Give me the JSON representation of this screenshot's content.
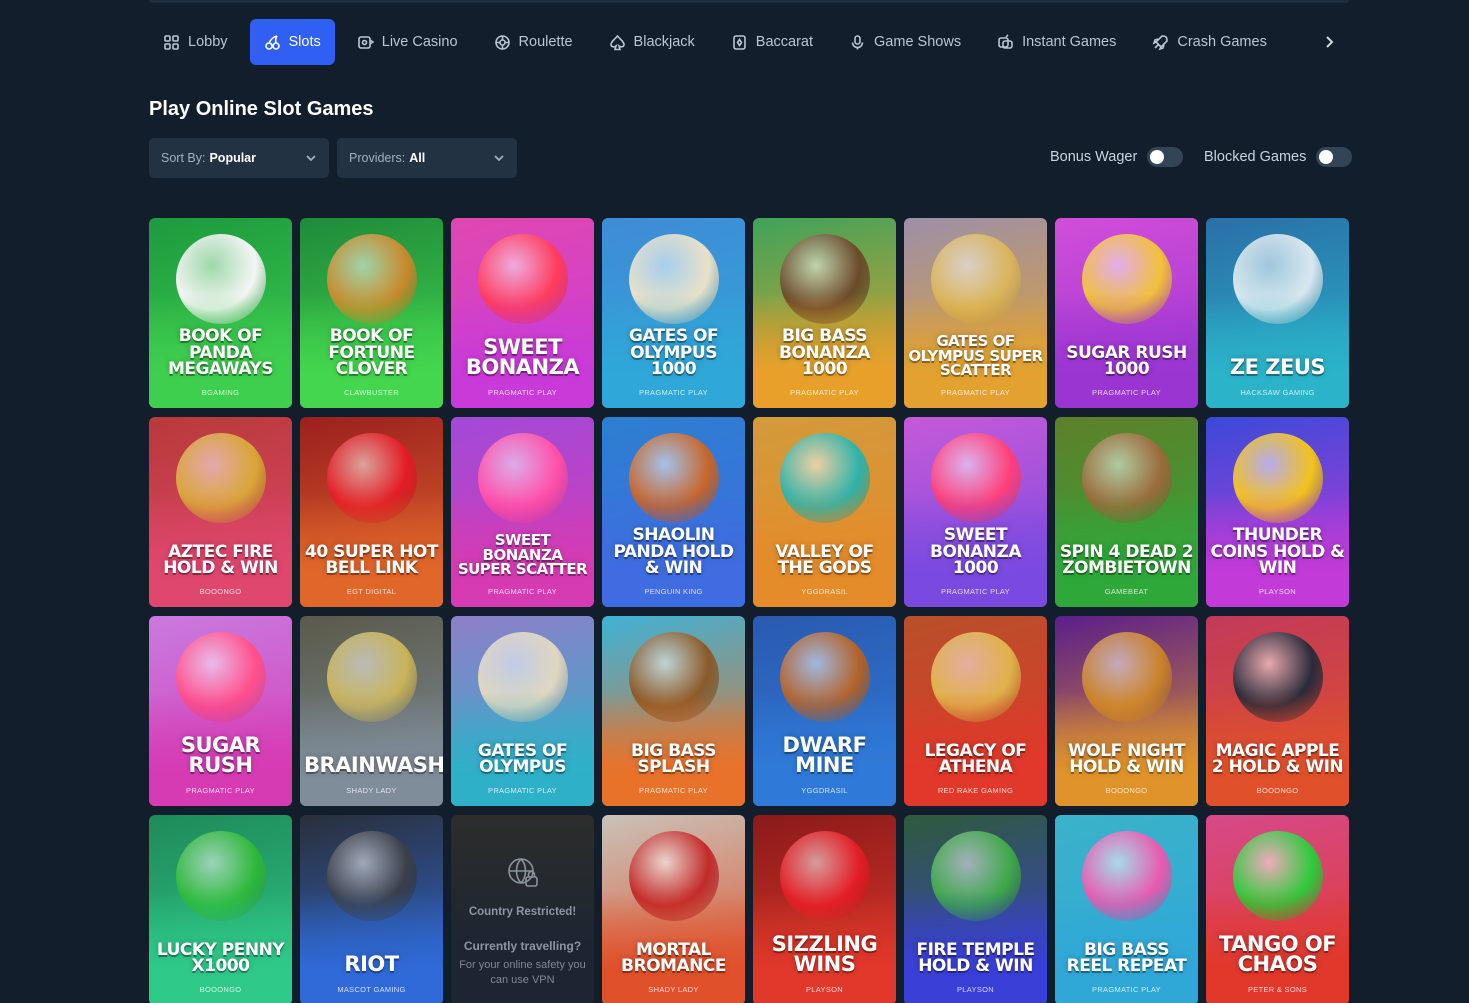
{
  "nav": {
    "items": [
      {
        "label": "Lobby",
        "icon": "grid-icon",
        "active": false
      },
      {
        "label": "Slots",
        "icon": "cherries-icon",
        "active": true
      },
      {
        "label": "Live Casino",
        "icon": "live-casino-icon",
        "active": false
      },
      {
        "label": "Roulette",
        "icon": "roulette-icon",
        "active": false
      },
      {
        "label": "Blackjack",
        "icon": "spade-icon",
        "active": false
      },
      {
        "label": "Baccarat",
        "icon": "card-icon",
        "active": false
      },
      {
        "label": "Game Shows",
        "icon": "microphone-icon",
        "active": false
      },
      {
        "label": "Instant Games",
        "icon": "instant-icon",
        "active": false
      },
      {
        "label": "Crash Games",
        "icon": "rocket-icon",
        "active": false
      }
    ]
  },
  "title": "Play Online Slot Games",
  "filters": {
    "sort_label": "Sort By:",
    "sort_value": "Popular",
    "providers_label": "Providers:",
    "providers_value": "All",
    "bonus_wager": "Bonus Wager",
    "blocked_games": "Blocked Games"
  },
  "games": [
    {
      "name": "Book of Panda Megaways",
      "provider": "BGAMING",
      "bg": "#1d9a3e",
      "bg2": "#3fcf4f",
      "accent": "#f5f5f5"
    },
    {
      "name": "Book of Fortune Clover",
      "provider": "CLAWBUSTER",
      "bg": "#1f8a3a",
      "bg2": "#43d64e",
      "accent": "#c8892c"
    },
    {
      "name": "Sweet Bonanza",
      "provider": "PRAGMATIC PLAY",
      "bg": "#e048b0",
      "bg2": "#c93bd8",
      "accent": "#ff3b5c"
    },
    {
      "name": "Gates of Olympus 1000",
      "provider": "PRAGMATIC PLAY",
      "bg": "#3f8bd6",
      "bg2": "#2fa7d8",
      "accent": "#e9e1c8"
    },
    {
      "name": "Big Bass Bonanza 1000",
      "provider": "PRAGMATIC PLAY",
      "bg": "#3ea35a",
      "bg2": "#e9a02a",
      "accent": "#6b4a2a"
    },
    {
      "name": "Gates of Olympus Super Scatter",
      "provider": "PRAGMATIC PLAY",
      "bg": "#9c8fa8",
      "bg2": "#e3a22f",
      "accent": "#d9b45a"
    },
    {
      "name": "Sugar Rush 1000",
      "provider": "PRAGMATIC PLAY",
      "bg": "#d14ed8",
      "bg2": "#9b35d2",
      "accent": "#f2c03a"
    },
    {
      "name": "Ze Zeus",
      "provider": "HACKSAW GAMING",
      "bg": "#2a6fa8",
      "bg2": "#2ab3c9",
      "accent": "#d9e7ef"
    },
    {
      "name": "Aztec Fire Hold & Win",
      "provider": "BOOONGO",
      "bg": "#b83a3a",
      "bg2": "#e0476e",
      "accent": "#d9a635"
    },
    {
      "name": "40 Super Hot Bell Link",
      "provider": "EGT DIGITAL",
      "bg": "#9c1f1f",
      "bg2": "#e0662a",
      "accent": "#e31c25"
    },
    {
      "name": "Sweet Bonanza Super Scatter",
      "provider": "PRAGMATIC PLAY",
      "bg": "#a14ad8",
      "bg2": "#d63bb4",
      "accent": "#ff4fa8"
    },
    {
      "name": "Shaolin Panda Hold & Win",
      "provider": "PENGUIN KING",
      "bg": "#2d7fd1",
      "bg2": "#3f6ce0",
      "accent": "#c8652a"
    },
    {
      "name": "Valley of the Gods",
      "provider": "YGGDRASIL",
      "bg": "#d39a3a",
      "bg2": "#e48b2a",
      "accent": "#2fb2a8"
    },
    {
      "name": "Sweet Bonanza 1000",
      "provider": "PRAGMATIC PLAY",
      "bg": "#c45ad8",
      "bg2": "#7a4ae0",
      "accent": "#ff3f7a"
    },
    {
      "name": "Spin 4 Dead 2 Zombietown",
      "provider": "GAMEBEAT",
      "bg": "#5f7f2a",
      "bg2": "#2fa83a",
      "accent": "#9a6a3a"
    },
    {
      "name": "Thunder Coins Hold & Win",
      "provider": "PLAYSON",
      "bg": "#3a4ad8",
      "bg2": "#c23ad8",
      "accent": "#f2c21a"
    },
    {
      "name": "Sugar Rush",
      "provider": "PRAGMATIC PLAY",
      "bg": "#c97ae0",
      "bg2": "#d63bb4",
      "accent": "#ff4f8a"
    },
    {
      "name": "Brainwashed",
      "provider": "SHADY LADY",
      "bg": "#5a5a4a",
      "bg2": "#7f8c99",
      "accent": "#c9b35a"
    },
    {
      "name": "Gates of Olympus",
      "provider": "PRAGMATIC PLAY",
      "bg": "#8f7fc9",
      "bg2": "#2fb0c9",
      "accent": "#e0d6c0"
    },
    {
      "name": "Big Bass Splash",
      "provider": "PRAGMATIC PLAY",
      "bg": "#3fb2d6",
      "bg2": "#e8722a",
      "accent": "#8a5a2a"
    },
    {
      "name": "Dwarf Mine",
      "provider": "YGGDRASIL",
      "bg": "#2a5ab0",
      "bg2": "#2f7ad8",
      "accent": "#b3622a"
    },
    {
      "name": "Legacy of Athena",
      "provider": "RED RAKE GAMING",
      "bg": "#b8502a",
      "bg2": "#e0382a",
      "accent": "#e0b24a"
    },
    {
      "name": "Wolf Night Hold & Win",
      "provider": "BOOONGO",
      "bg": "#5a1f8a",
      "bg2": "#e0932a",
      "accent": "#c9822a"
    },
    {
      "name": "Magic Apple 2 Hold & Win",
      "provider": "BOOONGO",
      "bg": "#c23a5a",
      "bg2": "#e0502a",
      "accent": "#2a2a3a"
    },
    {
      "name": "Lucky Penny x1000",
      "provider": "BOOONGO",
      "bg": "#1f8a5a",
      "bg2": "#2fc98a",
      "accent": "#2fb83a"
    },
    {
      "name": "Riot",
      "provider": "MASCOT GAMING",
      "bg": "#2a2f3a",
      "bg2": "#2f6ad8",
      "accent": "#3a3f4a"
    },
    {
      "name": "Mortal Bromance",
      "provider": "SHADY LADY",
      "bg": "#c9c2b8",
      "bg2": "#e0502a",
      "accent": "#c22a2a"
    },
    {
      "name": "Sizzling Wins",
      "provider": "PLAYSON",
      "bg": "#8a1a1a",
      "bg2": "#e0382a",
      "accent": "#e31c25"
    },
    {
      "name": "Fire Temple Hold & Win",
      "provider": "PLAYSON",
      "bg": "#2f5a3a",
      "bg2": "#3a3fd8",
      "accent": "#3fa84a"
    },
    {
      "name": "Big Bass Reel Repeat",
      "provider": "PRAGMATIC PLAY",
      "bg": "#3ab2c9",
      "bg2": "#2fa8d8",
      "accent": "#e85ab0"
    },
    {
      "name": "Tango of Chaos",
      "provider": "PETER & SONS",
      "bg": "#d64a8a",
      "bg2": "#e0382a",
      "accent": "#2fc93a"
    }
  ],
  "restricted": {
    "after_index": 25,
    "title": "Country Restricted!",
    "subtitle": "Currently travelling?",
    "body": "For your online safety you can use VPN",
    "icon": "globe-lock-icon"
  }
}
